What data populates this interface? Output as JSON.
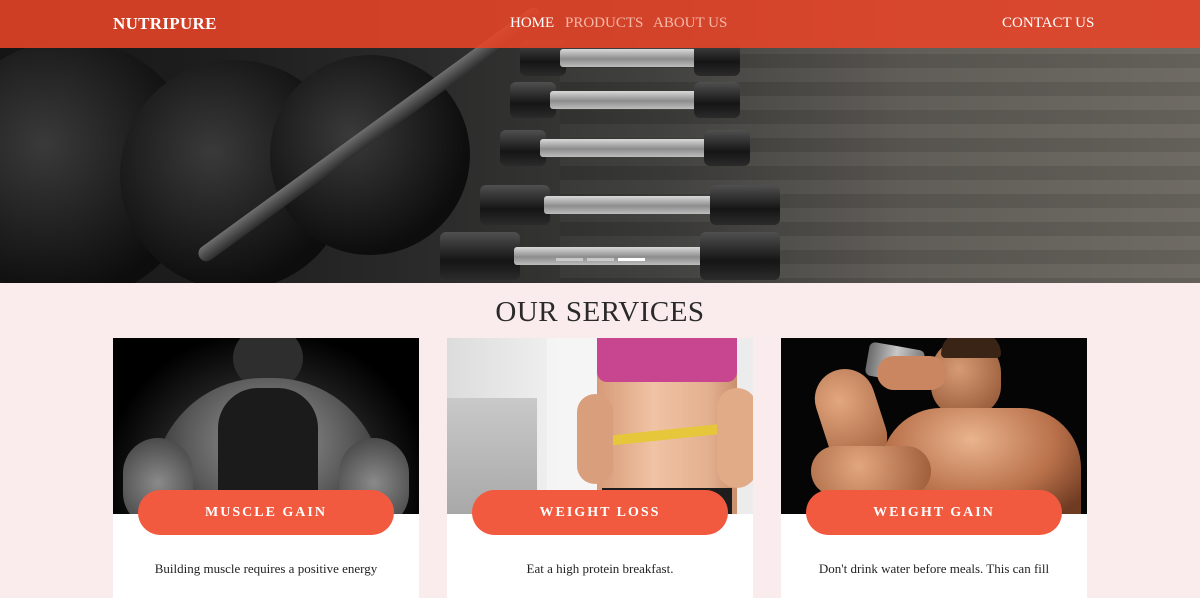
{
  "navbar": {
    "brand": "NUTRIPURE",
    "links": [
      {
        "label": "HOME",
        "active": true
      },
      {
        "label": "PRODUCTS",
        "active": false
      },
      {
        "label": "ABOUT US",
        "active": false
      }
    ],
    "contact": "CONTACT US",
    "background_color": "#e84428"
  },
  "hero": {
    "slides_count": 3,
    "active_slide": 3
  },
  "services": {
    "title": "OUR SERVICES",
    "cards": [
      {
        "label": "MUSCLE GAIN",
        "text": "Building muscle requires a positive energy"
      },
      {
        "label": "WEIGHT LOSS",
        "text": "Eat a high protein breakfast."
      },
      {
        "label": "WEIGHT GAIN",
        "text": "Don't drink water before meals. This can fill"
      }
    ],
    "accent_color": "#f25a3f"
  }
}
